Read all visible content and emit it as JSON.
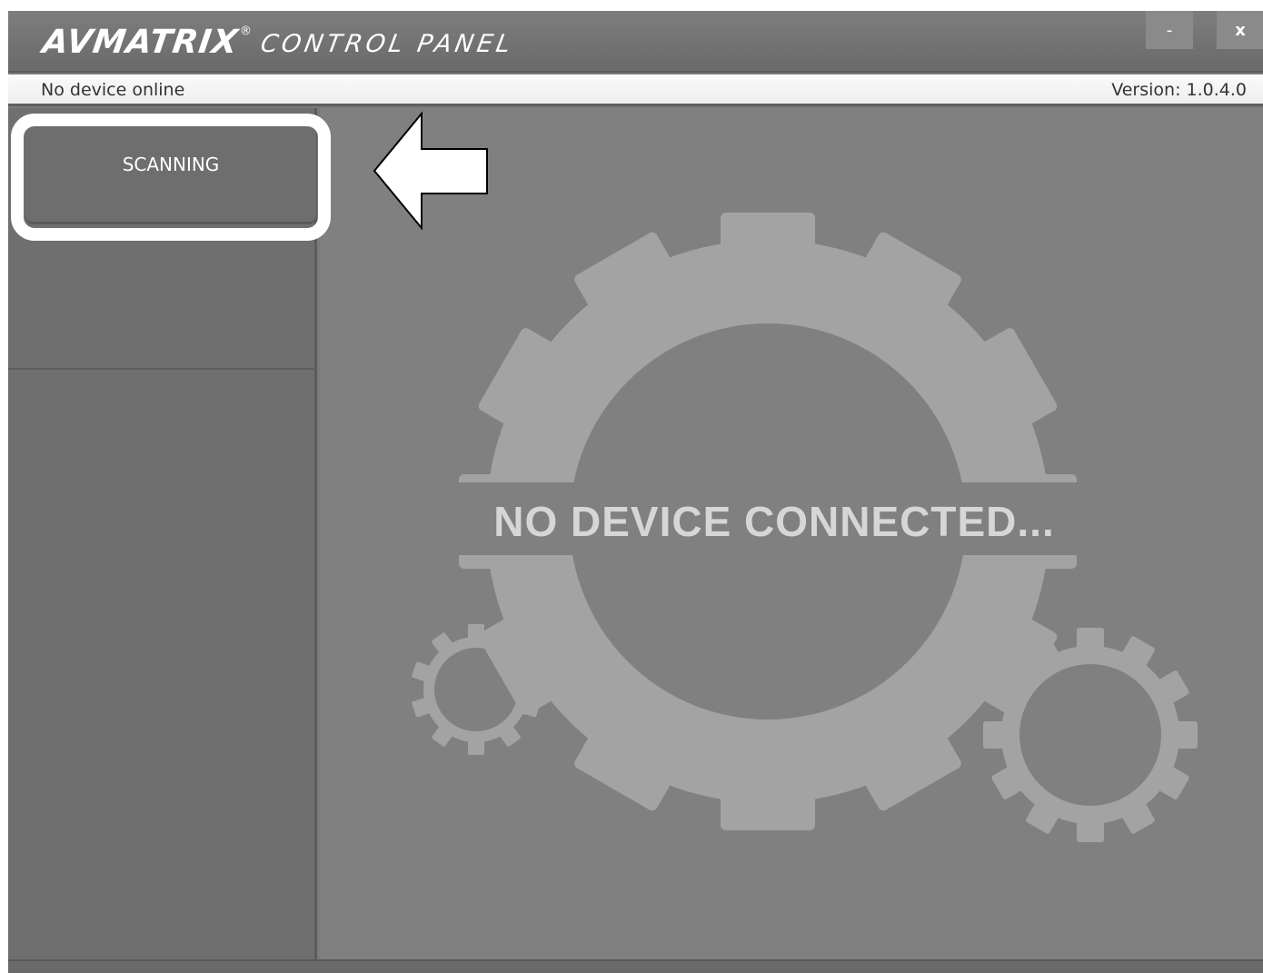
{
  "window": {
    "logo_brand": "AVMATRIX",
    "logo_registered": "®",
    "logo_subtitle": "CONTROL PANEL",
    "minimize_label": "-",
    "close_label": "x"
  },
  "status": {
    "left_text": "No device online",
    "version_text": "Version: 1.0.4.0"
  },
  "sidebar": {
    "scan_button_label": "SCANNING"
  },
  "main": {
    "message": "NO DEVICE CONNECTED..."
  },
  "colors": {
    "titlebar": "#747474",
    "main_bg": "#808080",
    "sidebar_bg": "#6f6f6f",
    "gear": "#a3a3a3",
    "message_text": "#d6d6d6",
    "highlight": "#ffffff"
  },
  "icons": {
    "gears": "gears-illustration",
    "arrow": "left-arrow-annotation"
  }
}
